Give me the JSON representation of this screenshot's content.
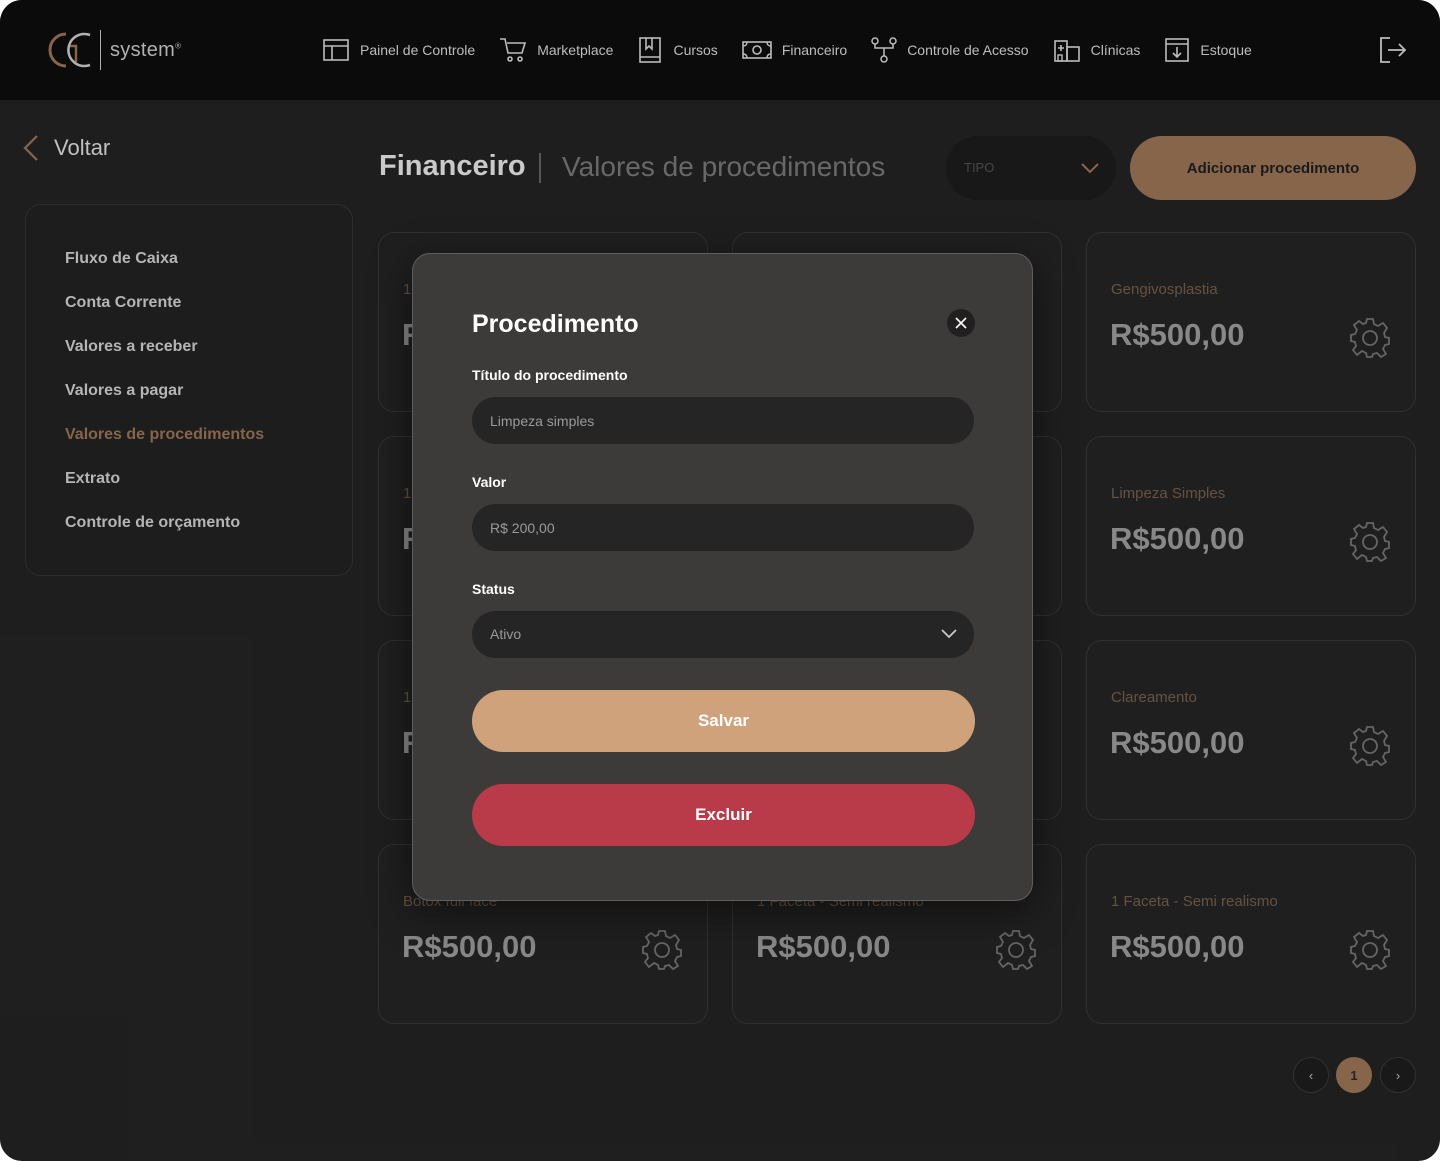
{
  "brand": {
    "logo_text": "system",
    "registered": "®"
  },
  "nav": {
    "items": [
      {
        "label": "Painel de Controle",
        "icon": "dashboard-icon"
      },
      {
        "label": "Marketplace",
        "icon": "cart-icon"
      },
      {
        "label": "Cursos",
        "icon": "book-icon"
      },
      {
        "label": "Financeiro",
        "icon": "money-icon"
      },
      {
        "label": "Controle de Acesso",
        "icon": "network-icon"
      },
      {
        "label": "Clínicas",
        "icon": "building-icon"
      },
      {
        "label": "Estoque",
        "icon": "inventory-icon"
      }
    ],
    "logout_icon": "logout-icon"
  },
  "back": {
    "label": "Voltar"
  },
  "sidebar": {
    "items": [
      {
        "label": "Fluxo de Caixa",
        "active": false
      },
      {
        "label": "Conta Corrente",
        "active": false
      },
      {
        "label": "Valores a receber",
        "active": false
      },
      {
        "label": "Valores a pagar",
        "active": false
      },
      {
        "label": "Valores de procedimentos",
        "active": true
      },
      {
        "label": "Extrato",
        "active": false
      },
      {
        "label": "Controle de orçamento",
        "active": false
      }
    ]
  },
  "header": {
    "title": "Financeiro",
    "subtitle": "Valores de procedimentos",
    "type_filter": "TIPO",
    "add_button": "Adicionar procedimento"
  },
  "cards": [
    {
      "title": "1",
      "price": "R"
    },
    {
      "title": "",
      "price": ""
    },
    {
      "title": "Gengivosplastia",
      "price": "R$500,00"
    },
    {
      "title": "1",
      "price": "R"
    },
    {
      "title": "",
      "price": ""
    },
    {
      "title": "Limpeza Simples",
      "price": "R$500,00"
    },
    {
      "title": "1",
      "price": "R"
    },
    {
      "title": "",
      "price": ""
    },
    {
      "title": "Clareamento",
      "price": "R$500,00"
    },
    {
      "title": "Botox full face",
      "price": "R$500,00"
    },
    {
      "title": "1 Faceta - Semi realismo",
      "price": "R$500,00"
    },
    {
      "title": "1 Faceta - Semi realismo",
      "price": "R$500,00"
    }
  ],
  "pagination": {
    "prev": "‹",
    "current": "1",
    "next": "›"
  },
  "modal": {
    "title": "Procedimento",
    "title_field_label": "Título do procedimento",
    "title_field_value": "Limpeza simples",
    "value_field_label": "Valor",
    "value_field_value": "R$ 200,00",
    "status_label": "Status",
    "status_value": "Ativo",
    "save_button": "Salvar",
    "delete_button": "Excluir"
  },
  "colors": {
    "accent": "#8c6a4f",
    "save": "#d0a27c",
    "delete": "#b93b4a",
    "background": "#202020",
    "topbar": "#0c0c0c"
  }
}
